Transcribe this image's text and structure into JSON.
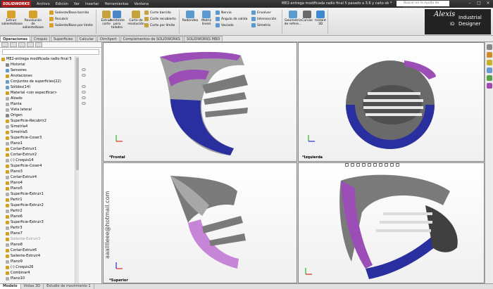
{
  "window": {
    "logo": "SOLIDWORKS",
    "title": "ME2-entrega modificada radio final 5 pasado a 3.6 y caño ok *",
    "help_placeholder": "Buscar en la ayuda de SOLIDWORKS",
    "menus": [
      "Archivo",
      "Edición",
      "Ver",
      "Insertar",
      "Herramientas",
      "Ventana"
    ]
  },
  "ribbon": {
    "big_buttons": [
      {
        "label": "Extruir saliente/base",
        "icon": "extrude-boss-icon"
      },
      {
        "label": "Revolución de saliente/base",
        "icon": "revolve-boss-icon"
      },
      {
        "label": "Extruir corte",
        "icon": "extrude-cut-icon"
      },
      {
        "label": "Asistente para taladro",
        "icon": "hole-wizard-icon"
      },
      {
        "label": "Corte de revolución",
        "icon": "revolve-cut-icon"
      },
      {
        "label": "Redondeo",
        "icon": "fillet-icon"
      },
      {
        "label": "Matriz lineal",
        "icon": "linear-pattern-icon"
      },
      {
        "label": "Geometría de refere...",
        "icon": "reference-geometry-icon"
      },
      {
        "label": "Curvas",
        "icon": "curves-icon"
      },
      {
        "label": "Instant 3D",
        "icon": "instant3d-icon"
      }
    ],
    "small_buttons": [
      {
        "label": "Saliente/Base barrido"
      },
      {
        "label": "Recubrir"
      },
      {
        "label": "Saliente/Base por límite"
      },
      {
        "label": "Corte barrido"
      },
      {
        "label": "Corte recubierto"
      },
      {
        "label": "Corte por límite"
      },
      {
        "label": "Nervio"
      },
      {
        "label": "Ángulo de salida"
      },
      {
        "label": "Vaciado"
      },
      {
        "label": "Envolver"
      },
      {
        "label": "Intersección"
      },
      {
        "label": "Simetría"
      }
    ],
    "brand": {
      "line1": "Alexis",
      "line2": "Industrial",
      "line3": "Designer",
      "mark": "ID"
    }
  },
  "tabs": [
    "Operaciones",
    "Croquis",
    "Superficies",
    "Calcular",
    "DimXpert",
    "Complementos de SOLIDWORKS",
    "SOLIDWORKS MBD"
  ],
  "tree": [
    {
      "label": "ME2-entrega modificada radio final 5",
      "dim": false
    },
    {
      "label": "Historial",
      "dim": false
    },
    {
      "label": "Sensores",
      "dim": false
    },
    {
      "label": "Anotaciones",
      "dim": false
    },
    {
      "label": "Conjuntos de superficies(22)",
      "dim": false
    },
    {
      "label": "Sólidos(14)",
      "dim": false
    },
    {
      "label": "Material <sin especificar>",
      "dim": false
    },
    {
      "label": "Alzado",
      "dim": false
    },
    {
      "label": "Planta",
      "dim": false
    },
    {
      "label": "Vista lateral",
      "dim": false
    },
    {
      "label": "Origen",
      "dim": false
    },
    {
      "label": "Superficie-Recubrir2",
      "dim": false
    },
    {
      "label": "Simetría4",
      "dim": false
    },
    {
      "label": "Simetría5",
      "dim": false
    },
    {
      "label": "Superficie-Coser3",
      "dim": false
    },
    {
      "label": "Plano1",
      "dim": false
    },
    {
      "label": "Cortar-Extruir1",
      "dim": false
    },
    {
      "label": "Cortar-Extruir2",
      "dim": false
    },
    {
      "label": "(-) Croquis14",
      "dim": false
    },
    {
      "label": "Superficie-Coser4",
      "dim": false
    },
    {
      "label": "Plano3",
      "dim": false
    },
    {
      "label": "Cortar-Extruir4",
      "dim": false
    },
    {
      "label": "Plano4",
      "dim": false
    },
    {
      "label": "Plano5",
      "dim": false
    },
    {
      "label": "Superficie-Extruir1",
      "dim": false
    },
    {
      "label": "Partir1",
      "dim": false
    },
    {
      "label": "Superficie-Extruir2",
      "dim": false
    },
    {
      "label": "Partir2",
      "dim": false
    },
    {
      "label": "Plano6",
      "dim": false
    },
    {
      "label": "Superficie-Extruir3",
      "dim": false
    },
    {
      "label": "Partir3",
      "dim": false
    },
    {
      "label": "Plano7",
      "dim": false
    },
    {
      "label": "Saliente-Extruir3",
      "dim": true
    },
    {
      "label": "Plano8",
      "dim": false
    },
    {
      "label": "Cortar-Extruir6",
      "dim": false
    },
    {
      "label": "Saliente-Extruir4",
      "dim": false
    },
    {
      "label": "Plano9",
      "dim": false
    },
    {
      "label": "(-) Croquis26",
      "dim": false
    },
    {
      "label": "Combinar4",
      "dim": false
    },
    {
      "label": "Plano10",
      "dim": false
    }
  ],
  "viewports": {
    "front": "*Frontal",
    "left": "*Izquierda",
    "top": "*Superior"
  },
  "watermark_email": "aaalllleee@hotmail.com",
  "bottom_tabs": [
    "Modelo",
    "Vistas 3D",
    "Estudio de movimiento 1"
  ],
  "colors": {
    "purple": "#9b4fb6",
    "blue": "#2a2fa0",
    "gray": "#6a6a6a",
    "light_gray": "#a8a8a8"
  }
}
